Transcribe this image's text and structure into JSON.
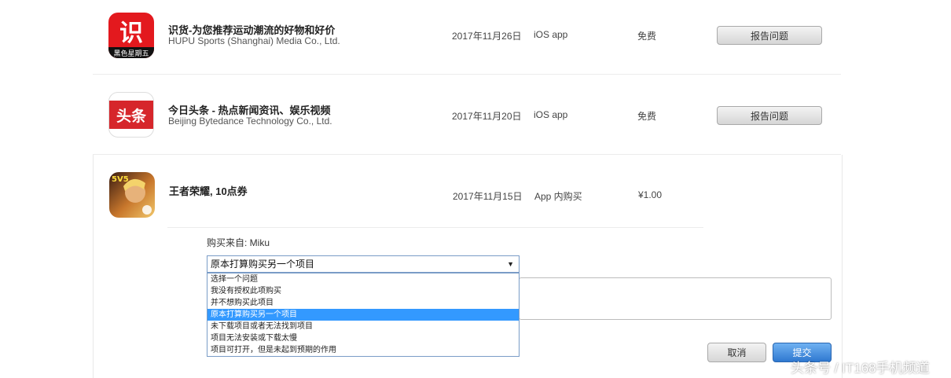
{
  "purchases": [
    {
      "icon_name": "shihuo-app-icon",
      "icon_text": "识",
      "icon_subtext": "黑色星期五",
      "title": "识货-为您推荐运动潮流的好物和好价",
      "developer": "HUPU Sports (Shanghai) Media Co., Ltd.",
      "date": "2017年11月26日",
      "type": "iOS app",
      "price": "免费",
      "action": "报告问题"
    },
    {
      "icon_name": "toutiao-app-icon",
      "icon_text": "头条",
      "title": "今日头条 - 热点新闻资讯、娱乐视频",
      "developer": "Beijing Bytedance Technology Co., Ltd.",
      "date": "2017年11月20日",
      "type": "iOS app",
      "price": "免费",
      "action": "报告问题"
    },
    {
      "icon_name": "honor-of-kings-app-icon",
      "icon_text": "5V5",
      "title": "王者荣耀, 10点券",
      "date": "2017年11月15日",
      "type": "App 内购买",
      "price": "¥1.00"
    }
  ],
  "report_form": {
    "purchased_from": "购买来自: Miku",
    "selected_reason": "原本打算购买另一个项目",
    "reason_options": [
      "选择一个问题",
      "我没有授权此项购买",
      "并不想购买此项目",
      "原本打算购买另一个项目",
      "未下载项目或者无法找到项目",
      "项目无法安装或下载太慢",
      "项目可打开，但是未起到预期的作用"
    ],
    "highlighted_index": 3,
    "cancel_label": "取消",
    "submit_label": "提交"
  },
  "watermark": "头条号 / IT168手机频道",
  "colors": {
    "submit_blue": "#2f78d0",
    "selection_blue": "#3399ff",
    "shihuo_red": "#e3191e",
    "toutiao_red": "#d6262b"
  }
}
